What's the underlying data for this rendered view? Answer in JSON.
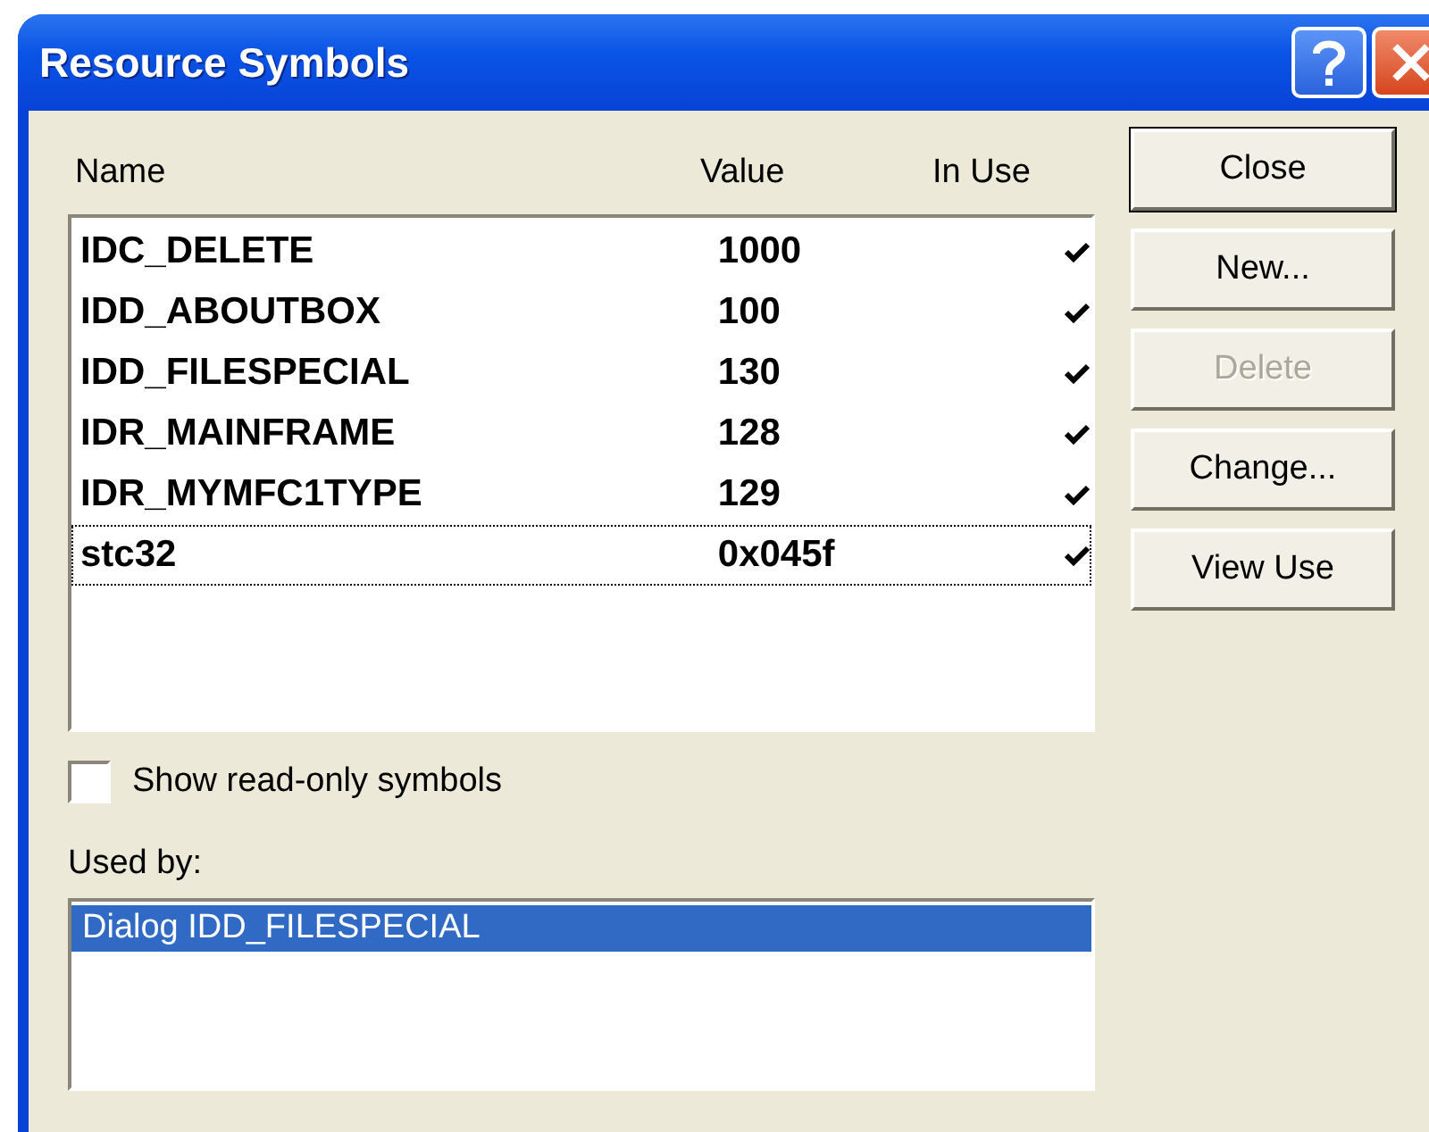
{
  "window": {
    "title": "Resource Symbols"
  },
  "symbols": {
    "columns": [
      "Name",
      "Value",
      "In Use"
    ],
    "rows": [
      {
        "name": "IDC_DELETE",
        "value": "1000",
        "in_use": true,
        "focused": false
      },
      {
        "name": "IDD_ABOUTBOX",
        "value": "100",
        "in_use": true,
        "focused": false
      },
      {
        "name": "IDD_FILESPECIAL",
        "value": "130",
        "in_use": true,
        "focused": false
      },
      {
        "name": "IDR_MAINFRAME",
        "value": "128",
        "in_use": true,
        "focused": false
      },
      {
        "name": "IDR_MYMFC1TYPE",
        "value": "129",
        "in_use": true,
        "focused": false
      },
      {
        "name": "stc32",
        "value": "0x045f",
        "in_use": true,
        "focused": true
      }
    ]
  },
  "buttons": [
    {
      "label": "Close",
      "default": true,
      "disabled": false
    },
    {
      "label": "New...",
      "default": false,
      "disabled": false
    },
    {
      "label": "Delete",
      "default": false,
      "disabled": true
    },
    {
      "label": "Change...",
      "default": false,
      "disabled": false
    },
    {
      "label": "View Use",
      "default": false,
      "disabled": false
    }
  ],
  "show_read_only": {
    "label": "Show read-only symbols",
    "checked": false
  },
  "used_by": {
    "label": "Used by:",
    "items": [
      {
        "text": "Dialog IDD_FILESPECIAL",
        "selected": true
      }
    ]
  }
}
